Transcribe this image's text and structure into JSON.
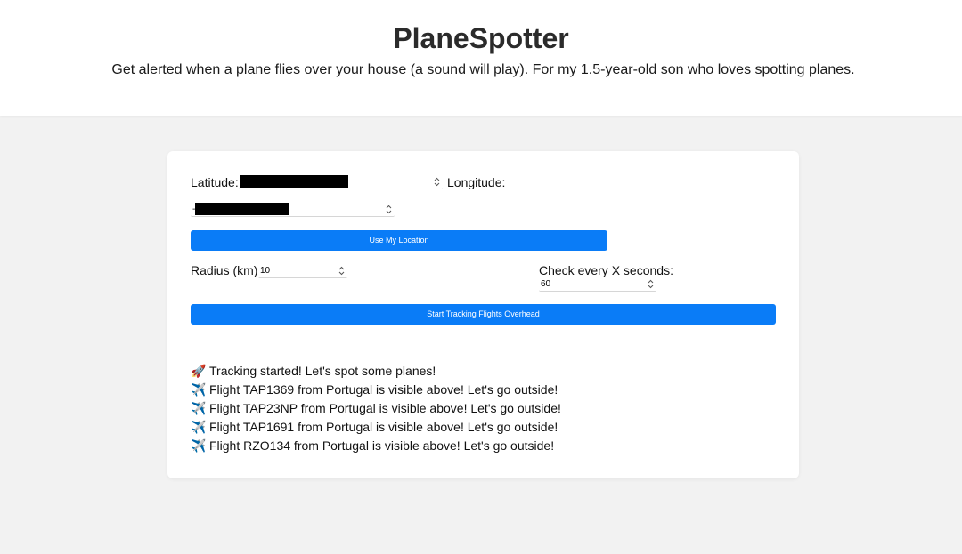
{
  "header": {
    "title": "PlaneSpotter",
    "tagline": "Get alerted when a plane flies over your house (a sound will play). For my 1.5-year-old son who loves spotting planes."
  },
  "form": {
    "latitude_label": "Latitude:",
    "longitude_label": "Longitude:",
    "longitude_prefix": "-",
    "use_location_label": "Use My Location",
    "radius_label": "Radius (km):",
    "radius_value": "10",
    "interval_label": "Check every X seconds:",
    "interval_value": "60",
    "start_label": "Start Tracking Flights Overhead"
  },
  "log": [
    {
      "icon": "🚀",
      "icon_name": "rocket-icon",
      "text": "Tracking started! Let's spot some planes!"
    },
    {
      "icon": "✈️",
      "icon_name": "airplane-icon",
      "text": "Flight TAP1369 from Portugal is visible above! Let's go outside!"
    },
    {
      "icon": "✈️",
      "icon_name": "airplane-icon",
      "text": "Flight TAP23NP from Portugal is visible above! Let's go outside!"
    },
    {
      "icon": "✈️",
      "icon_name": "airplane-icon",
      "text": "Flight TAP1691 from Portugal is visible above! Let's go outside!"
    },
    {
      "icon": "✈️",
      "icon_name": "airplane-icon",
      "text": "Flight RZO134 from Portugal is visible above! Let's go outside!"
    }
  ],
  "colors": {
    "accent": "#0a7cf7",
    "page_background": "#f2f2f2",
    "card_background": "#ffffff"
  }
}
